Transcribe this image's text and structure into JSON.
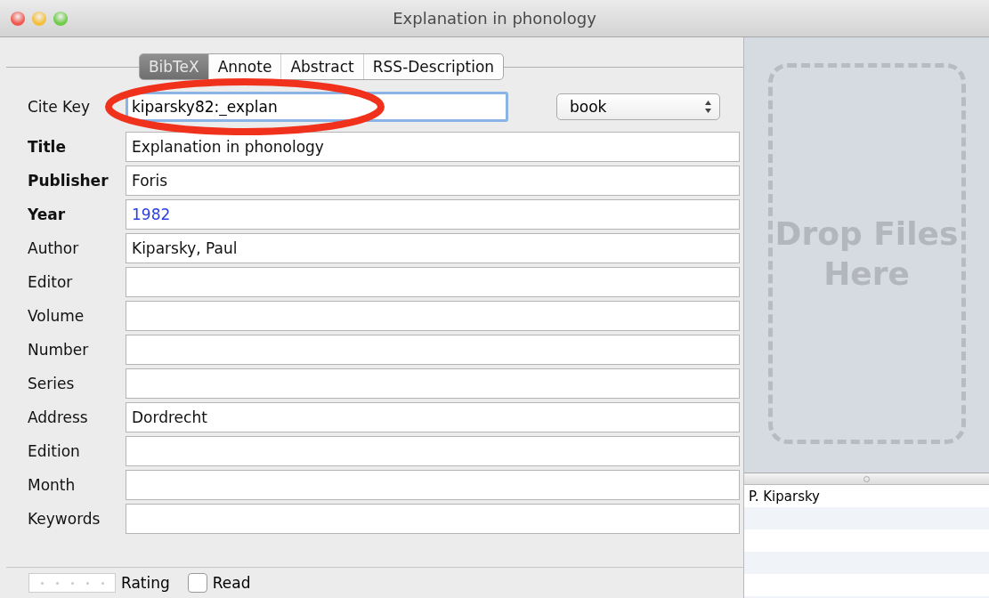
{
  "window": {
    "title": "Explanation in phonology"
  },
  "tabs": [
    {
      "label": "BibTeX",
      "selected": true
    },
    {
      "label": "Annote",
      "selected": false
    },
    {
      "label": "Abstract",
      "selected": false
    },
    {
      "label": "RSS-Description",
      "selected": false
    }
  ],
  "cite_key": {
    "label": "Cite Key",
    "value": "kiparsky82:_explan",
    "circled": true
  },
  "type_popup": {
    "value": "book"
  },
  "fields": [
    {
      "label": "Title",
      "value": "Explanation in phonology",
      "required": true,
      "highlighted": false
    },
    {
      "label": "Publisher",
      "value": "Foris",
      "required": true,
      "highlighted": false
    },
    {
      "label": "Year",
      "value": "1982",
      "required": true,
      "highlighted": true
    },
    {
      "label": "Author",
      "value": "Kiparsky, Paul",
      "required": false,
      "highlighted": false
    },
    {
      "label": "Editor",
      "required": false
    },
    {
      "label": "Volume",
      "required": false
    },
    {
      "label": "Number",
      "required": false
    },
    {
      "label": "Series",
      "required": false
    },
    {
      "label": "Address",
      "value": "Dordrecht",
      "required": false,
      "highlighted": false
    },
    {
      "label": "Edition",
      "required": false
    },
    {
      "label": "Month",
      "required": false
    },
    {
      "label": "Keywords",
      "required": false
    }
  ],
  "rating": {
    "label": "Rating",
    "stars": 0
  },
  "read": {
    "label": "Read",
    "checked": false
  },
  "drop_zone": {
    "label": "Drop Files Here"
  },
  "authors": [
    {
      "name": "P. Kiparsky"
    }
  ]
}
